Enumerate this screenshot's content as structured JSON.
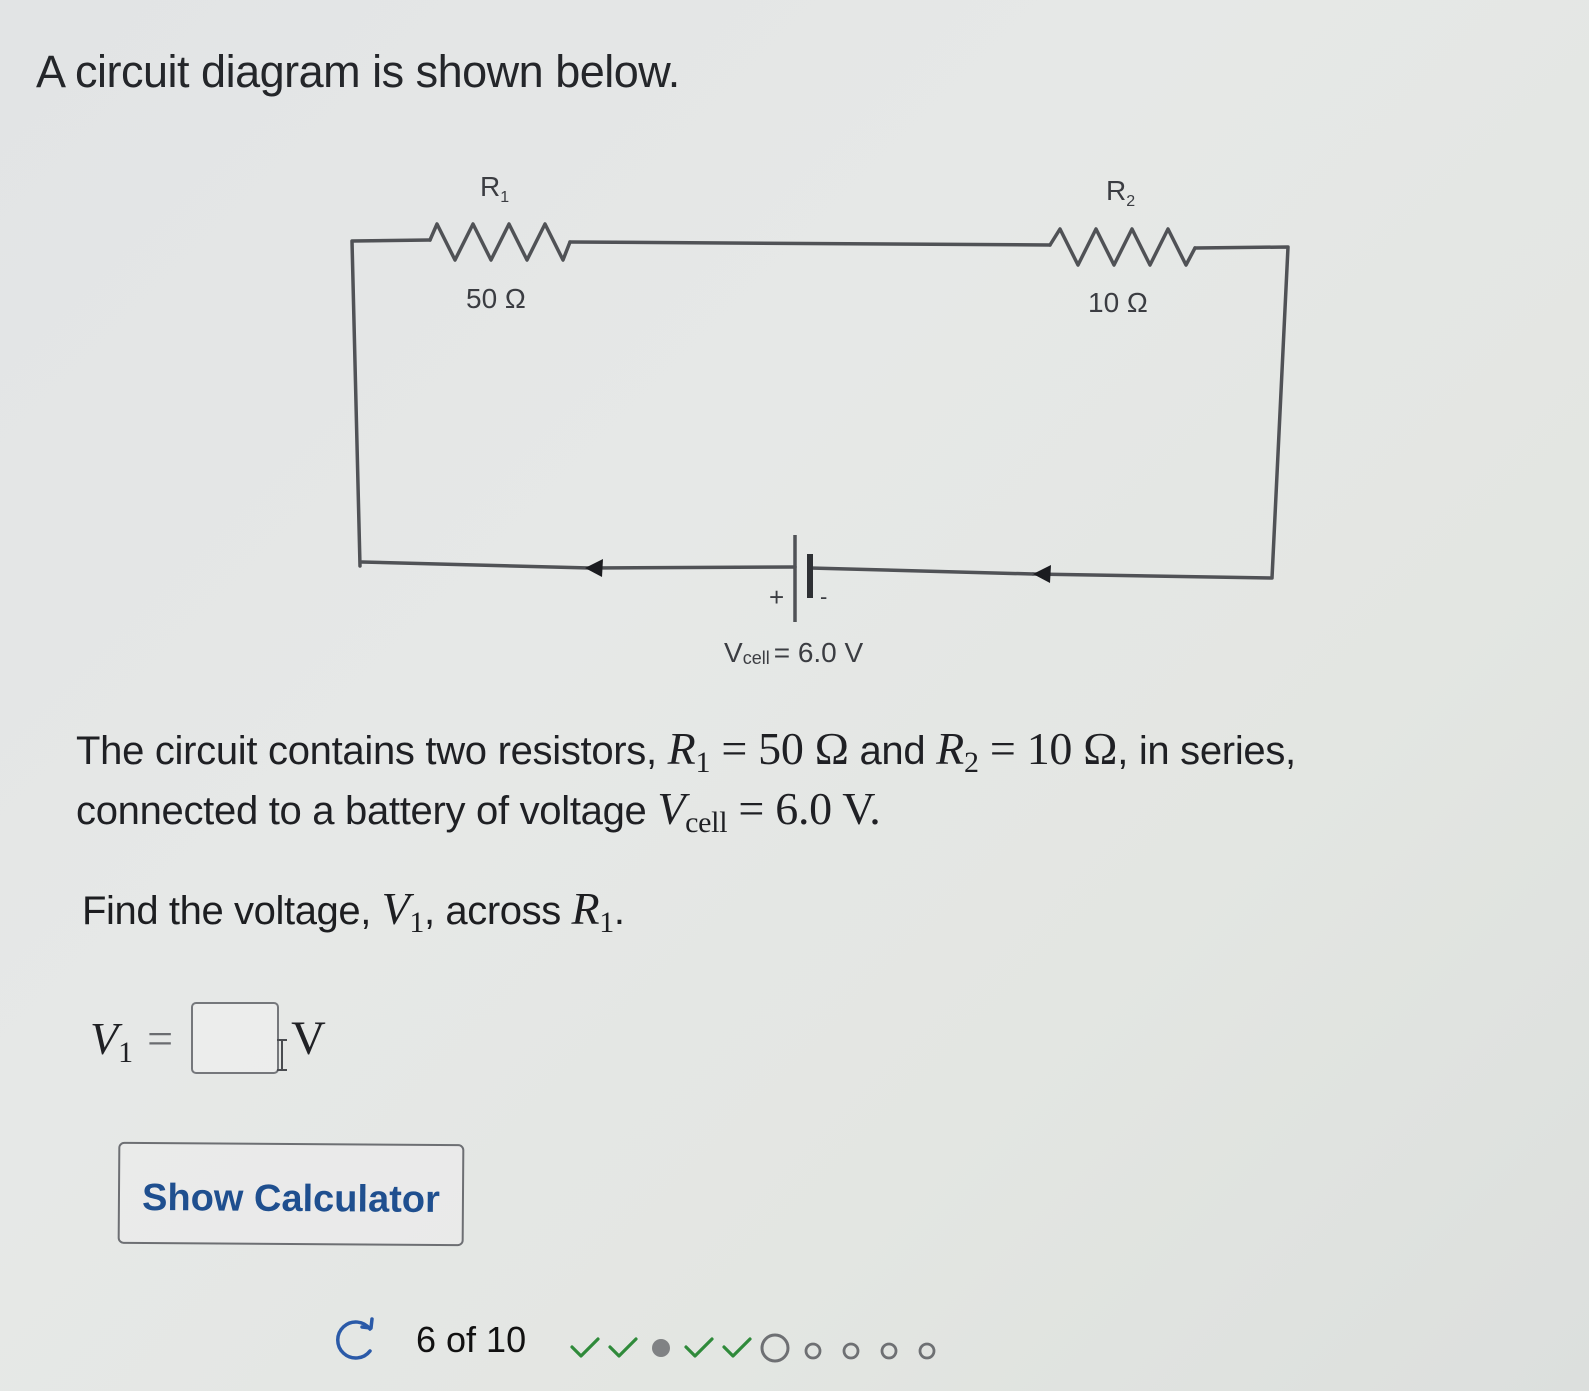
{
  "intro": "A circuit diagram is shown below.",
  "circuit": {
    "r1_label": "R",
    "r1_sub": "1",
    "r1_value": "50 Ω",
    "r2_label": "R",
    "r2_sub": "2",
    "r2_value": "10  Ω",
    "battery_plus": "+",
    "battery_minus": "-",
    "vcell_prefix": "V",
    "vcell_sub": "cell",
    "vcell_value": "= 6.0 V"
  },
  "paragraph": {
    "part1": "The circuit contains two resistors, ",
    "r1_sym": "R",
    "r1_sub": "1",
    "r1_eq": " = 50 Ω",
    "part2": " and ",
    "r2_sym": "R",
    "r2_sub": "2",
    "r2_eq": " = 10 Ω",
    "part3": ", in series,",
    "part4": "connected to a battery of voltage ",
    "v_sym": "V",
    "v_sub": "cell",
    "v_eq": " = 6.0 V."
  },
  "question": {
    "part1": "Find the voltage, ",
    "v_sym": "V",
    "v_sub": "1",
    "part2": ", across ",
    "r_sym": "R",
    "r_sub": "1",
    "part3": "."
  },
  "answer": {
    "lhs_sym": "V",
    "lhs_sub": "1",
    "equals": "=",
    "value": "",
    "placeholder": "",
    "unit": "V"
  },
  "buttons": {
    "show_calculator": "Show Calculator"
  },
  "progress": {
    "retry_icon": "retry-icon",
    "text": "6 of 10",
    "current": 6,
    "total": 10,
    "statuses": [
      "correct",
      "correct",
      "skipped",
      "correct",
      "correct",
      "current",
      "unanswered",
      "unanswered",
      "unanswered",
      "unanswered"
    ],
    "colors": {
      "correct": "#2f8a3a",
      "skipped": "#808284",
      "current": "#6e7073",
      "unanswered": "#6e7073",
      "retry": "#2a5aa8"
    }
  }
}
